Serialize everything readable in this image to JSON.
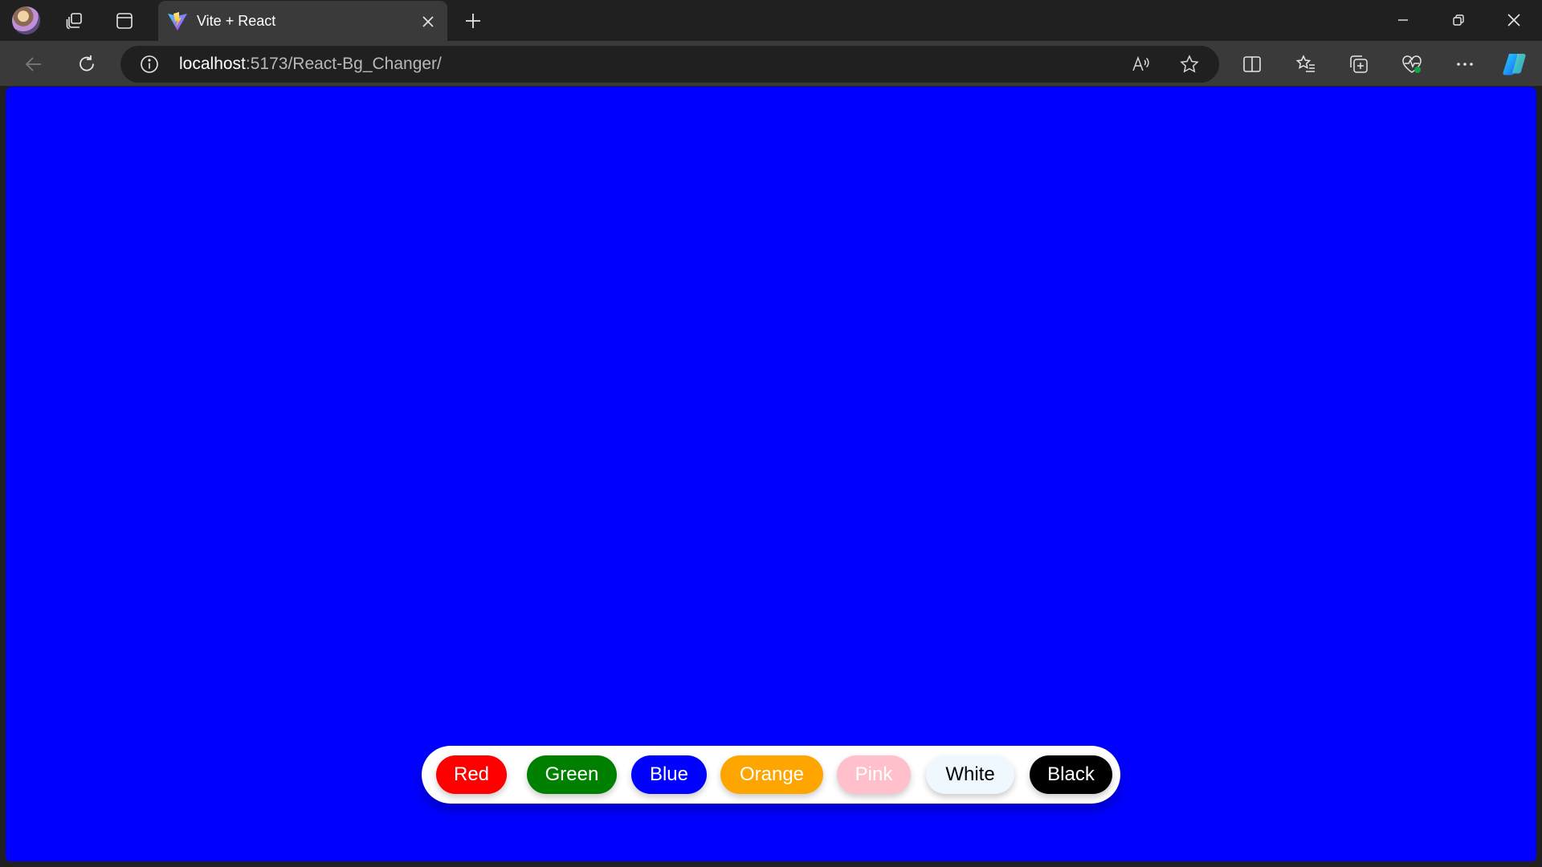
{
  "browser": {
    "tab": {
      "title": "Vite + React",
      "favicon": "vite-logo-icon"
    },
    "address": {
      "host": "localhost",
      "rest": ":5173/React-Bg_Changer/"
    },
    "titlebar_icons": [
      "profile-avatar",
      "workspaces-icon",
      "tab-actions-icon"
    ],
    "toolbar_icons": [
      "back-icon",
      "refresh-icon",
      "info-icon",
      "read-aloud-icon",
      "favorite-star-icon",
      "split-screen-icon",
      "favorites-list-icon",
      "collections-icon",
      "browser-essentials-icon",
      "more-icon",
      "copilot-icon"
    ],
    "window_controls": [
      "minimize-icon",
      "restore-icon",
      "close-icon"
    ]
  },
  "page": {
    "background": "#0000ff",
    "buttons": [
      {
        "label": "Red",
        "bg": "#ff0000",
        "fg": "#ffffff"
      },
      {
        "label": "Green",
        "bg": "#008000",
        "fg": "#ffffff"
      },
      {
        "label": "Blue",
        "bg": "#0000ff",
        "fg": "#ffffff"
      },
      {
        "label": "Orange",
        "bg": "#ffa500",
        "fg": "#ffffff"
      },
      {
        "label": "Pink",
        "bg": "#ffc0cb",
        "fg": "#ffffff"
      },
      {
        "label": "White",
        "bg": "#f0f8ff",
        "fg": "#000000"
      },
      {
        "label": "Black",
        "bg": "#000000",
        "fg": "#ffffff"
      }
    ]
  }
}
